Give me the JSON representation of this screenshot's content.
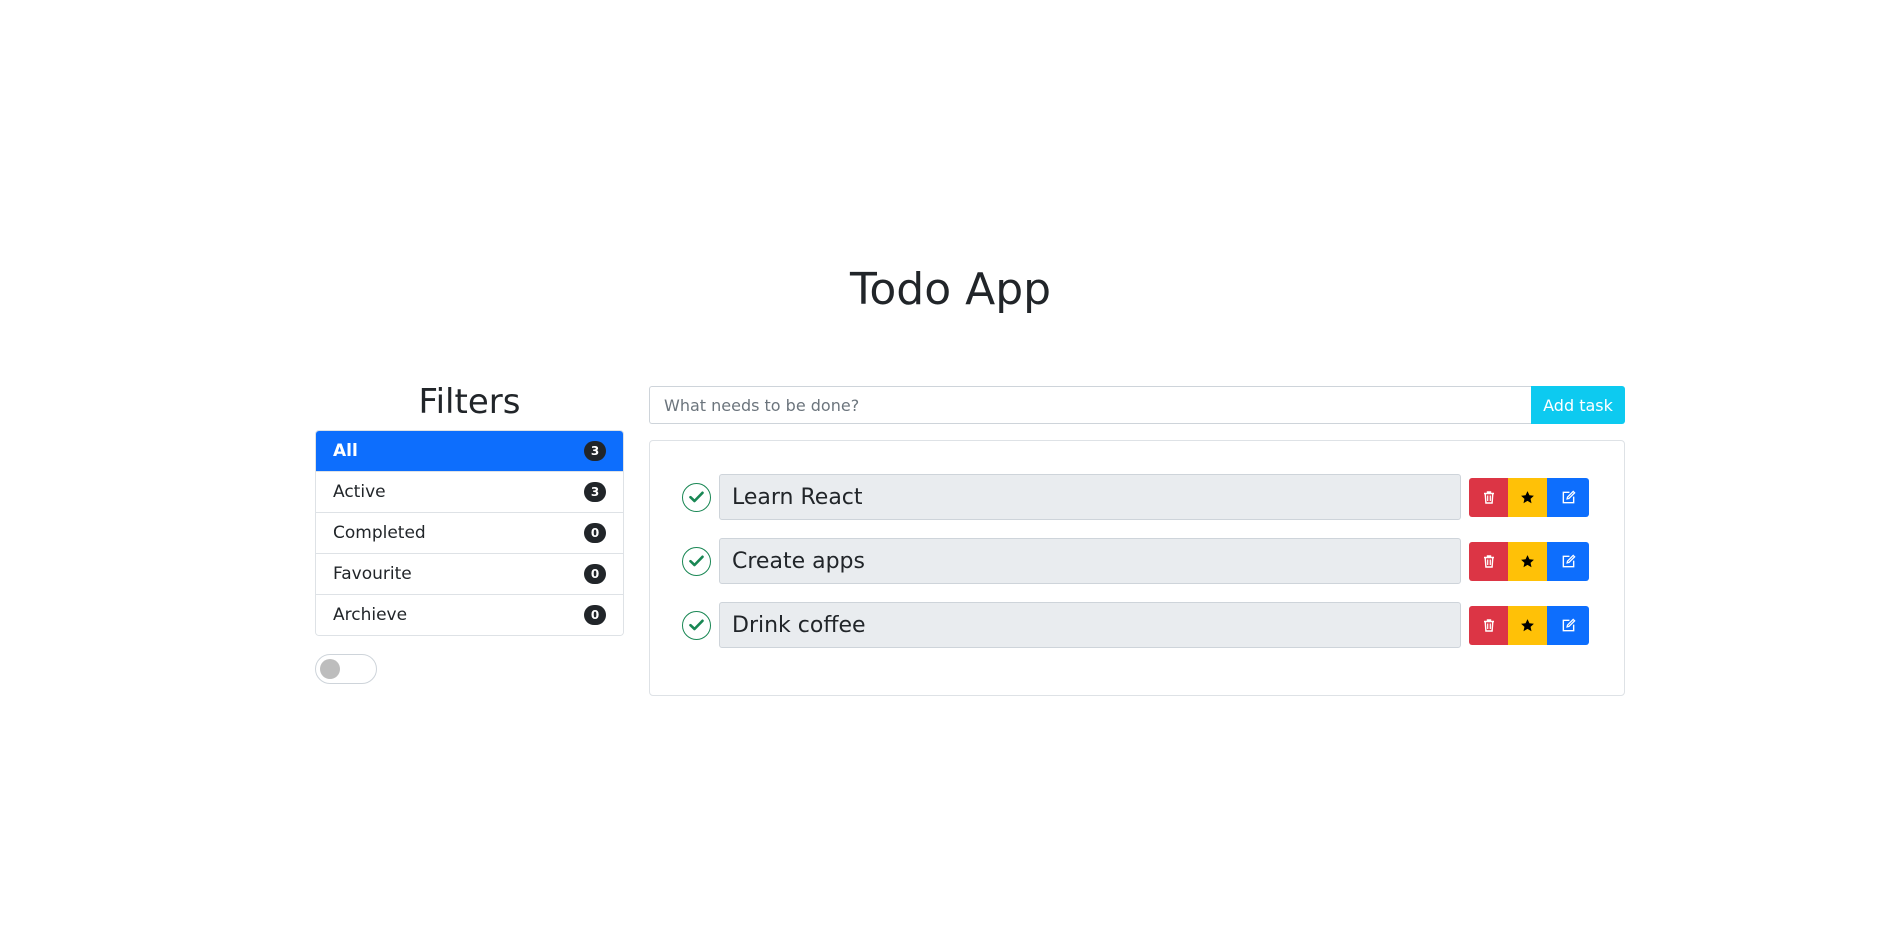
{
  "app": {
    "title": "Todo App"
  },
  "sidebar": {
    "title": "Filters",
    "filters": [
      {
        "label": "All",
        "count": "3",
        "active": true
      },
      {
        "label": "Active",
        "count": "3",
        "active": false
      },
      {
        "label": "Completed",
        "count": "0",
        "active": false
      },
      {
        "label": "Favourite",
        "count": "0",
        "active": false
      },
      {
        "label": "Archieve",
        "count": "0",
        "active": false
      }
    ],
    "toggle": {
      "on": false
    }
  },
  "main": {
    "input": {
      "placeholder": "What needs to be done?",
      "value": ""
    },
    "add_label": "Add task",
    "tasks": [
      {
        "text": "Learn React"
      },
      {
        "text": "Create apps"
      },
      {
        "text": "Drink coffee"
      }
    ],
    "actions": {
      "delete_icon": "trash-icon",
      "favourite_icon": "star-icon",
      "edit_icon": "edit-icon"
    }
  },
  "colors": {
    "primary": "#0d6efd",
    "info": "#0dcaf0",
    "danger": "#dc3545",
    "warning": "#ffc107",
    "success": "#198754",
    "dark": "#212529"
  }
}
